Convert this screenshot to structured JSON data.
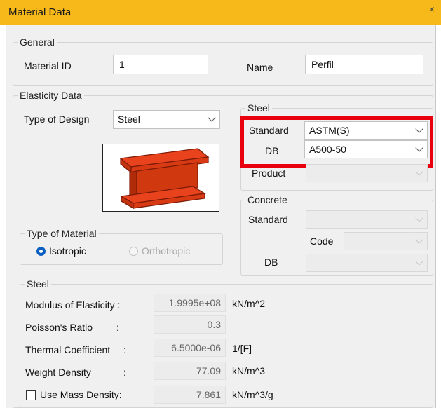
{
  "window": {
    "title": "Material Data",
    "close_glyph": "×"
  },
  "general": {
    "legend": "General",
    "material_id_label": "Material ID",
    "material_id_value": "1",
    "name_label": "Name",
    "name_value": "Perfil"
  },
  "elasticity": {
    "legend": "Elasticity Data",
    "type_of_design_label": "Type of Design",
    "type_of_design_value": "Steel",
    "section_image_icon": "i-beam-icon"
  },
  "steel_code": {
    "legend": "Steel",
    "standard_label": "Standard",
    "standard_value": "ASTM(S)",
    "db_label": "DB",
    "db_value": "A500-50",
    "product_label": "Product",
    "highlight_color": "#e8000f"
  },
  "concrete_code": {
    "legend": "Concrete",
    "standard_label": "Standard",
    "code_label": "Code",
    "db_label": "DB"
  },
  "material_type": {
    "legend": "Type of Material",
    "isotropic_label": "Isotropic",
    "orthotropic_label": "Orthotropic",
    "selected": "Isotropic"
  },
  "steel_props": {
    "legend": "Steel",
    "rows": [
      {
        "label": "Modulus of Elasticity :",
        "value": "1.9995e+08",
        "unit": "kN/m^2"
      },
      {
        "label": "Poisson's Ratio",
        "colon": ":",
        "value": "0.3",
        "unit": ""
      },
      {
        "label": "Thermal Coefficient",
        "colon": ":",
        "value": "6.5000e-06",
        "unit": "1/[F]"
      },
      {
        "label": "Weight Density",
        "colon": ":",
        "value": "77.09",
        "unit": "kN/m^3"
      },
      {
        "label": "Use Mass Density:",
        "value": "7.861",
        "unit": "kN/m^3/g",
        "checked": false
      }
    ]
  },
  "colors": {
    "title_bar": "#f7b81a",
    "beam": "#e8431c",
    "radio_selected": "#0b5fc0"
  }
}
